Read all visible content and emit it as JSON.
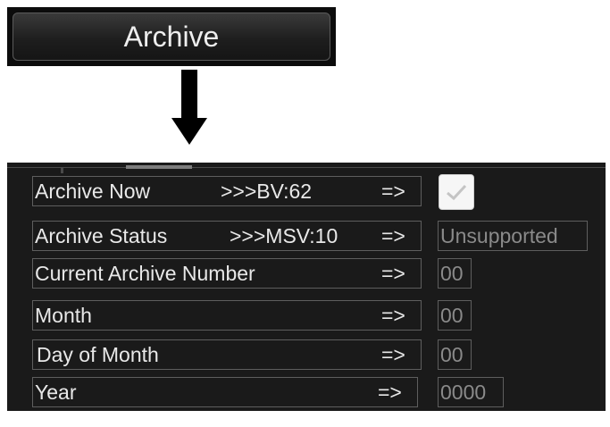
{
  "button": {
    "label": "Archive"
  },
  "rows": [
    {
      "label": "Archive Now",
      "code": ">>>BV:62",
      "arrow": "=>",
      "control": "checkbox",
      "checked": true
    },
    {
      "label": "Archive Status",
      "code": ">>>MSV:10",
      "arrow": "=>",
      "value": "Unsupported"
    },
    {
      "label": "Current Archive Number",
      "arrow": "=>",
      "value": "00"
    },
    {
      "label": "Month",
      "arrow": "=>",
      "value": "00"
    },
    {
      "label": "Day  of Month",
      "arrow": "=>",
      "value": "00"
    },
    {
      "label": "Year",
      "arrow": "=>",
      "value": "0000"
    }
  ],
  "colors": {
    "panel_bg": "#1a1a1a",
    "text": "#e8e8e8",
    "value_text": "#8a8a8a",
    "border": "#5e5e5e"
  },
  "icons": {
    "arrow": "down-arrow-icon",
    "checkbox": "checkmark-icon"
  }
}
